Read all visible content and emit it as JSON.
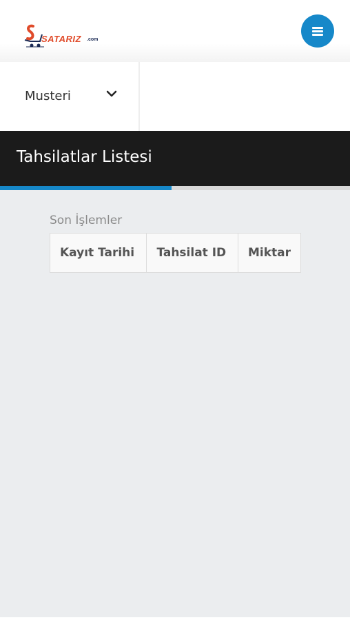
{
  "header": {
    "logo_text": "SATARIZ",
    "logo_suffix": ".com",
    "menu_icon": "hamburger-menu-icon"
  },
  "nav": {
    "items": [
      {
        "label": "Musteri",
        "icon": "chevron-down-icon"
      }
    ]
  },
  "page": {
    "title": "Tahsilatlar Listesi",
    "progress": 0.49
  },
  "recent": {
    "label": "Son İşlemler",
    "columns": [
      "Kayıt Tarihi",
      "Tahsilat ID",
      "Miktar"
    ]
  },
  "colors": {
    "accent": "#1688c9",
    "title_bar": "#1b1b1b",
    "content_bg": "#ebedef"
  }
}
